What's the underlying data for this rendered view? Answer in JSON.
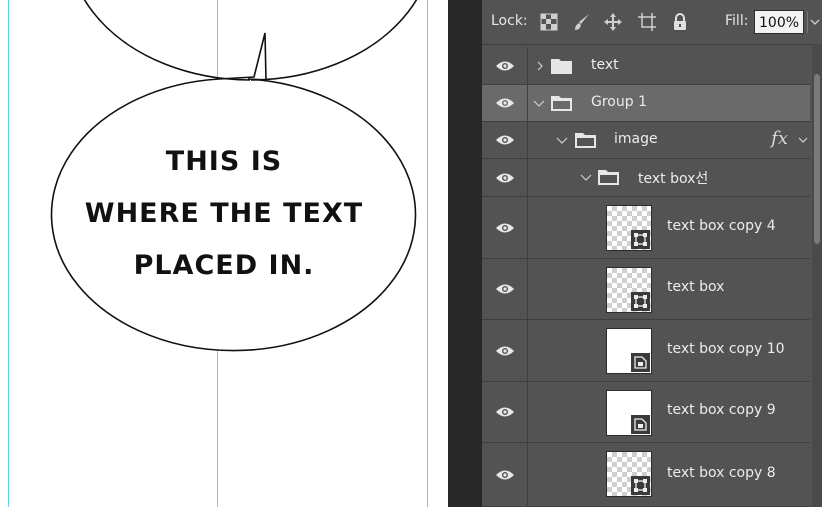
{
  "canvas": {
    "bubble_text_lines": [
      "THIS IS",
      "WHERE THE TEXT",
      "PLACED IN."
    ]
  },
  "layers_panel": {
    "lock_label": "Lock:",
    "lock_icons": [
      "lock-transparent-pixels-icon",
      "lock-image-pixels-icon",
      "lock-position-icon",
      "lock-artboard-icon",
      "lock-all-icon"
    ],
    "fill_label": "Fill:",
    "fill_value": "100%",
    "layers": [
      {
        "name": "text",
        "kind": "group",
        "expanded": false,
        "selected": false
      },
      {
        "name": "Group 1",
        "kind": "group",
        "expanded": true,
        "selected": true
      },
      {
        "name": "image",
        "kind": "group",
        "expanded": true,
        "selected": false,
        "effects": "fx"
      },
      {
        "name": "text box선",
        "kind": "group",
        "expanded": true,
        "selected": false
      },
      {
        "name": "text box copy 4",
        "kind": "smart-object",
        "selected": false
      },
      {
        "name": "text box",
        "kind": "smart-object",
        "selected": false
      },
      {
        "name": "text box copy 10",
        "kind": "smart-object",
        "selected": false
      },
      {
        "name": "text box copy 9",
        "kind": "smart-object",
        "selected": false
      },
      {
        "name": "text box copy 8",
        "kind": "smart-object",
        "selected": false
      }
    ]
  },
  "colors": {
    "panel_bg": "#535353",
    "selected_row": "#6a6a6a",
    "guide": "#5fd3e0"
  }
}
